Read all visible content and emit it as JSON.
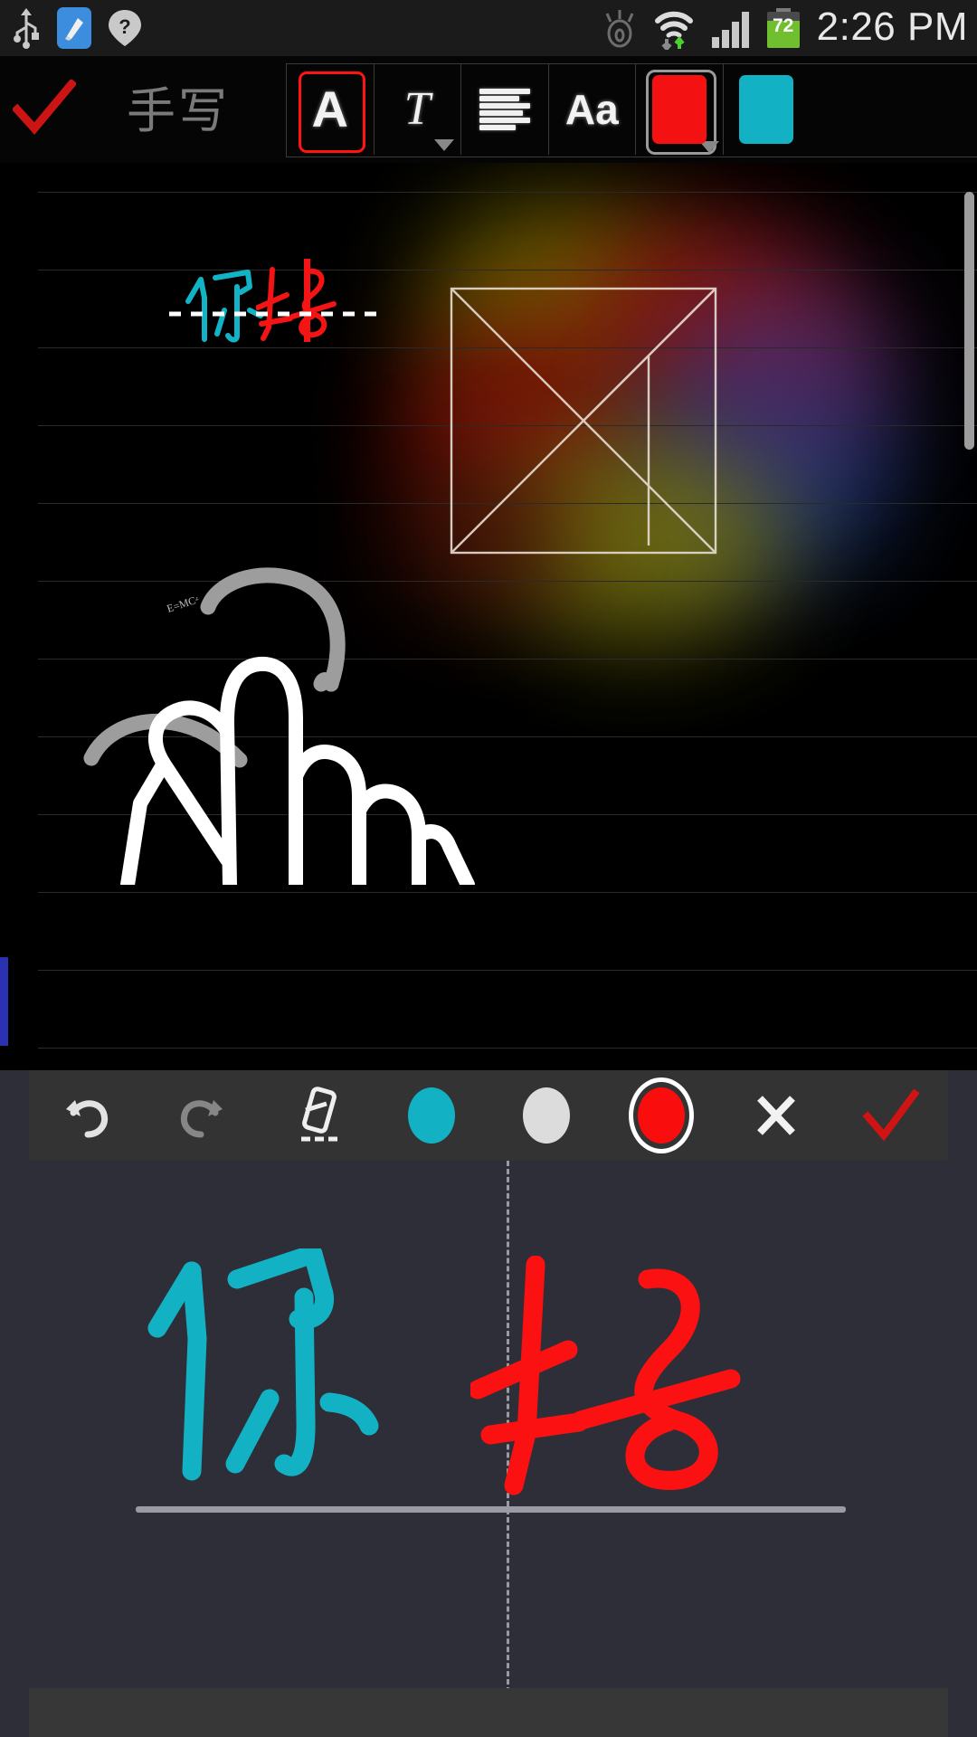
{
  "status_bar": {
    "time": "2:26 PM",
    "battery_level": "72",
    "icons": [
      "usb-icon",
      "screenshot-icon",
      "unknown-network-icon",
      "smart-stay-icon",
      "wifi-icon",
      "signal-icon",
      "battery-icon"
    ]
  },
  "top_toolbar": {
    "confirm_label": "confirm-check",
    "title": "手写",
    "tools": [
      {
        "name": "font-style-button",
        "glyph": "A",
        "selected": true,
        "has_dropdown": false
      },
      {
        "name": "text-italic-button",
        "glyph": "T",
        "selected": false,
        "has_dropdown": true
      },
      {
        "name": "text-align-button",
        "glyph": "align-lines",
        "selected": false,
        "has_dropdown": false
      },
      {
        "name": "font-size-button",
        "glyph": "Aa",
        "selected": false,
        "has_dropdown": false
      },
      {
        "name": "primary-color-swatch",
        "glyph": "swatch",
        "color": "#f41111",
        "selected": true,
        "has_dropdown": true
      },
      {
        "name": "secondary-color-swatch",
        "glyph": "swatch",
        "color": "#13b1c4",
        "selected": false,
        "has_dropdown": false
      }
    ],
    "collapse_icon": "chevron-down-icon"
  },
  "canvas": {
    "recognized_text_cyan": "你",
    "recognized_text_red": "好",
    "annotation_text": "E=MC²",
    "shape_name": "tangram-square",
    "ruled_lines": 11,
    "scrollbar_present": true
  },
  "handwriting_panel": {
    "tools": [
      {
        "name": "undo-button",
        "icon": "undo-icon"
      },
      {
        "name": "redo-button",
        "icon": "redo-icon"
      },
      {
        "name": "eraser-button",
        "icon": "eraser-icon"
      },
      {
        "name": "color-cyan-button",
        "icon": "color-dot",
        "color": "#13b1c4",
        "selected": false
      },
      {
        "name": "color-white-button",
        "icon": "color-dot",
        "color": "#dcdcdc",
        "selected": false
      },
      {
        "name": "color-red-button",
        "icon": "color-dot",
        "color": "#f90d0d",
        "selected": true
      },
      {
        "name": "close-button",
        "icon": "close-x-icon"
      },
      {
        "name": "accept-button",
        "icon": "check-icon"
      }
    ],
    "strokes": [
      {
        "character": "你",
        "color": "#13b1c4"
      },
      {
        "character": "好",
        "color": "#fb1111"
      }
    ],
    "divider_style": "dashed",
    "baseline_visible": true
  },
  "colors": {
    "accent_red": "#ff1414",
    "accent_cyan": "#13b1c4",
    "status_bar_bg": "#1b1b1b",
    "toolbar_bg": "#050505",
    "hw_panel_bg": "#2e2e38",
    "hw_toolbar_bg": "#333333",
    "battery_green": "#6fbf2f"
  }
}
